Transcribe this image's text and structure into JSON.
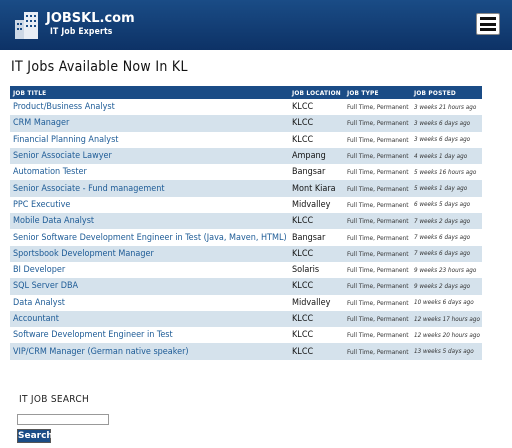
{
  "header": {
    "brand": "JOBSKL.com",
    "tagline": "IT Job Experts",
    "menu_icon": "hamburger-menu-icon",
    "logo_icon": "building-logo-icon"
  },
  "page_title": "IT Jobs Available Now In KL",
  "table": {
    "headers": [
      "JOB TITLE",
      "JOB LOCATION",
      "JOB TYPE",
      "JOB POSTED"
    ],
    "rows": [
      {
        "title": "Product/Business Analyst",
        "location": "KLCC",
        "type": "Full Time, Permanent",
        "posted": "3 weeks 21 hours ago"
      },
      {
        "title": "CRM Manager",
        "location": "KLCC",
        "type": "Full Time, Permanent",
        "posted": "3 weeks 6 days ago"
      },
      {
        "title": "Financial Planning Analyst",
        "location": "KLCC",
        "type": "Full Time, Permanent",
        "posted": "3 weeks 6 days ago"
      },
      {
        "title": "Senior Associate Lawyer",
        "location": "Ampang",
        "type": "Full Time, Permanent",
        "posted": "4 weeks 1 day ago"
      },
      {
        "title": "Automation Tester",
        "location": "Bangsar",
        "type": "Full Time, Permanent",
        "posted": "5 weeks 16 hours ago"
      },
      {
        "title": "Senior Associate - Fund management",
        "location": "Mont Kiara",
        "type": "Full Time, Permanent",
        "posted": "5 weeks 1 day ago"
      },
      {
        "title": "PPC Executive",
        "location": "Midvalley",
        "type": "Full Time, Permanent",
        "posted": "6 weeks 5 days ago"
      },
      {
        "title": "Mobile Data Analyst",
        "location": "KLCC",
        "type": "Full Time, Permanent",
        "posted": "7 weeks 2 days ago"
      },
      {
        "title": "Senior Software Development Engineer in Test (Java, Maven, HTML)",
        "location": "Bangsar",
        "type": "Full Time, Permanent",
        "posted": "7 weeks 6 days ago"
      },
      {
        "title": "Sportsbook Development Manager",
        "location": "KLCC",
        "type": "Full Time, Permanent",
        "posted": "7 weeks 6 days ago"
      },
      {
        "title": "BI Developer",
        "location": "Solaris",
        "type": "Full Time, Permanent",
        "posted": "9 weeks 23 hours ago"
      },
      {
        "title": "SQL Server DBA",
        "location": "KLCC",
        "type": "Full Time, Permanent",
        "posted": "9 weeks 2 days ago"
      },
      {
        "title": "Data Analyst",
        "location": "Midvalley",
        "type": "Full Time, Permanent",
        "posted": "10 weeks 6 days ago"
      },
      {
        "title": "Accountant",
        "location": "KLCC",
        "type": "Full Time, Permanent",
        "posted": "12 weeks 17 hours ago"
      },
      {
        "title": "Software Development Engineer in Test",
        "location": "KLCC",
        "type": "Full Time, Permanent",
        "posted": "12 weeks 20 hours ago"
      },
      {
        "title": "VIP/CRM Manager (German native speaker)",
        "location": "KLCC",
        "type": "Full Time, Permanent",
        "posted": "13 weeks 5 days ago"
      }
    ]
  },
  "search": {
    "title": "IT JOB SEARCH",
    "input_value": "",
    "button_label": "Search"
  },
  "colors": {
    "header_bg": "#1a4c86",
    "row_alt_bg": "#d5e2ec",
    "link": "#1d5b96"
  }
}
